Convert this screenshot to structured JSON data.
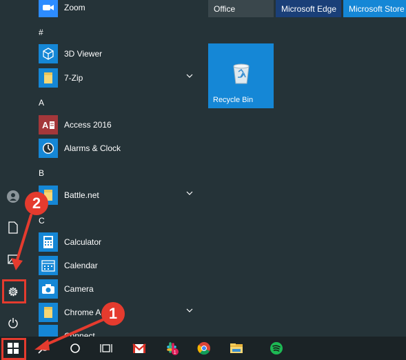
{
  "top_tiles": [
    "Office",
    "Microsoft Edge",
    "Microsoft Store"
  ],
  "recycle_bin": {
    "label": "Recycle Bin"
  },
  "app_list": {
    "zoom": "Zoom",
    "hash": "#",
    "viewer3d": "3D Viewer",
    "zip7": "7-Zip",
    "a": "A",
    "access": "Access 2016",
    "alarms": "Alarms & Clock",
    "b": "B",
    "battlenet": "Battle.net",
    "c": "C",
    "calculator": "Calculator",
    "calendar": "Calendar",
    "camera": "Camera",
    "chrome": "Chrome A",
    "connect": "Connect"
  },
  "annotations": {
    "step1": "1",
    "step2": "2"
  },
  "colors": {
    "accent": "#1587d6",
    "annotation": "#e53b2e"
  }
}
